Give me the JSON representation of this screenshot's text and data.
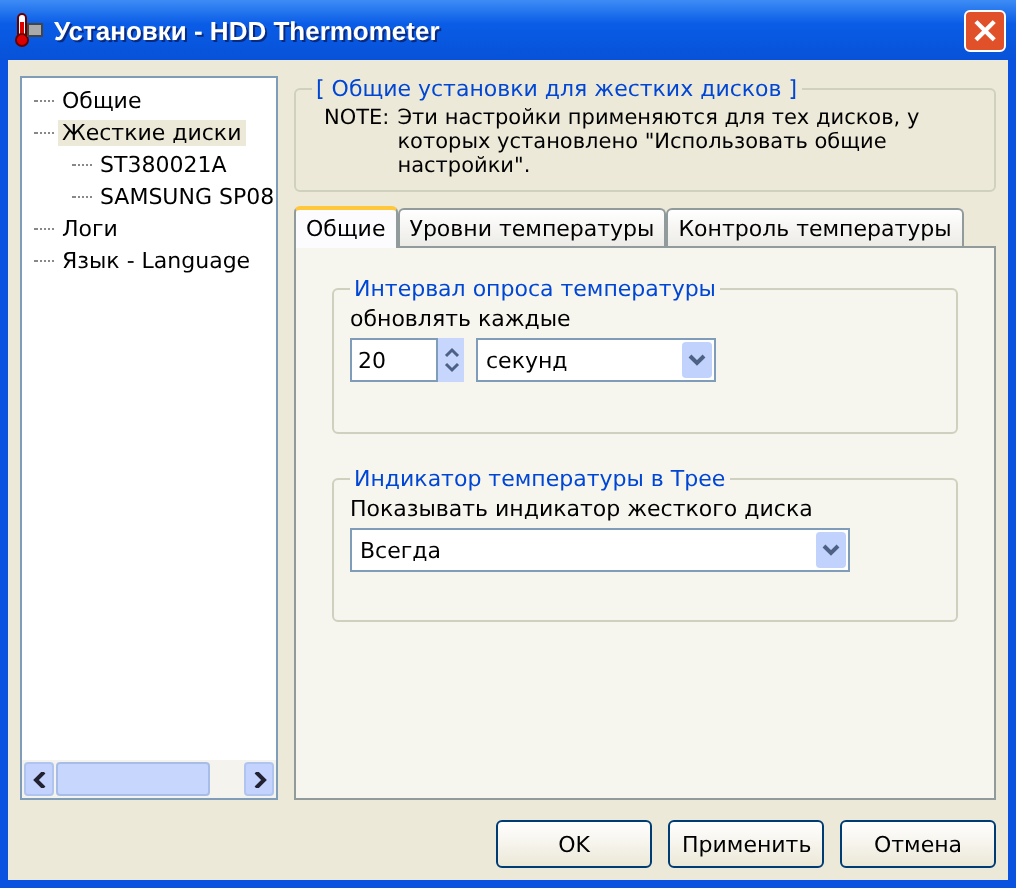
{
  "window": {
    "title": "Установки - HDD Thermometer",
    "close": "×"
  },
  "tree": [
    {
      "label": "Общие",
      "selected": false
    },
    {
      "label": "Жесткие диски",
      "selected": true,
      "children": [
        {
          "label": "ST380021A",
          "selected": false
        },
        {
          "label": "SAMSUNG SP08",
          "selected": false
        }
      ]
    },
    {
      "label": "Логи",
      "selected": false
    },
    {
      "label": "Язык - Language",
      "selected": false
    }
  ],
  "info": {
    "title": "[ Общие установки для жестких дисков ]",
    "note_label": "NOTE:",
    "note": "Эти настройки применяются для тех дисков, у которых установлено \"Использовать общие настройки\"."
  },
  "tabs": [
    {
      "label": "Общие",
      "selected": true
    },
    {
      "label": "Уровни температуры",
      "selected": false
    },
    {
      "label": "Контроль температуры",
      "selected": false
    }
  ],
  "interval": {
    "title": "Интервал опроса температуры",
    "label": "обновлять каждые",
    "value": "20",
    "unit": "секунд"
  },
  "tray": {
    "title": "Индикатор температуры в Трее",
    "label": "Показывать индикатор жесткого диска",
    "value": "Всегда"
  },
  "buttons": [
    "OK",
    "Применить",
    "Отмена"
  ]
}
